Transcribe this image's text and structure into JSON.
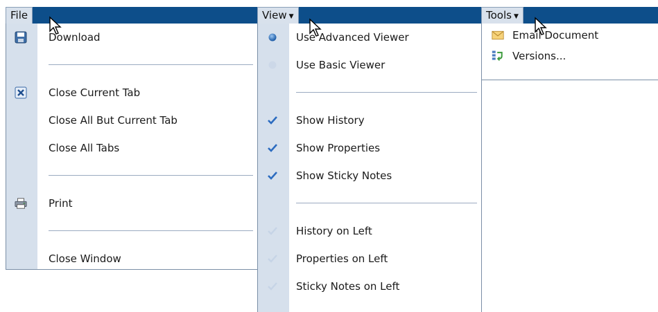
{
  "file_menu": {
    "title": "File",
    "items": {
      "download": "Download",
      "close_current_tab": "Close Current Tab",
      "close_all_but_current": "Close All But Current Tab",
      "close_all_tabs": "Close All Tabs",
      "print": "Print",
      "close_window": "Close Window"
    }
  },
  "view_menu": {
    "title": "View",
    "items": {
      "use_advanced_viewer": "Use Advanced Viewer",
      "use_basic_viewer": "Use Basic Viewer",
      "show_history": "Show History",
      "show_properties": "Show Properties",
      "show_sticky_notes": "Show Sticky Notes",
      "history_on_left": "History on Left",
      "properties_on_left": "Properties on Left",
      "sticky_notes_on_left": "Sticky Notes on Left"
    },
    "state": {
      "selected_viewer": "advanced",
      "show_history": true,
      "show_properties": true,
      "show_sticky_notes": true,
      "history_on_left": false,
      "properties_on_left": false,
      "sticky_notes_on_left": false
    }
  },
  "tools_menu": {
    "title": "Tools",
    "items": {
      "email_document": "Email Document",
      "versions": "Versions..."
    }
  },
  "colors": {
    "menubar": "#0d4e8a",
    "tab_bg": "#d8e1ec",
    "gutter": "#d6e0ec",
    "check": "#2c6cc0",
    "separator": "#9aaac0"
  },
  "icons": {
    "download": "floppy-disk-icon",
    "close_tab": "close-tab-icon",
    "print": "printer-icon",
    "radio_selected": "radio-dot-icon",
    "check": "checkmark-icon",
    "email": "envelope-icon",
    "versions": "versions-icon",
    "cursor": "mouse-pointer-icon"
  }
}
